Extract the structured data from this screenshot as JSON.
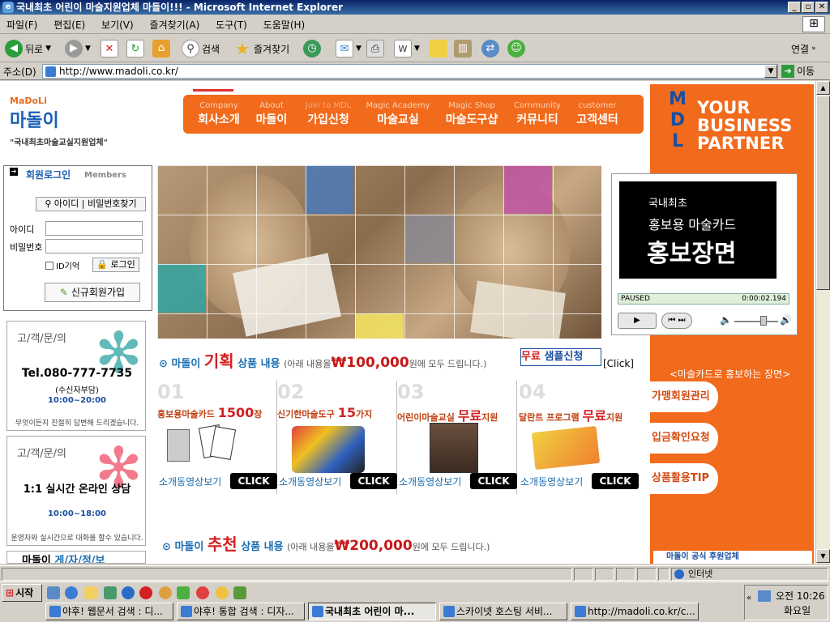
{
  "window": {
    "title": "국내최초 어린이 마술지원업체 마돌이!!! - Microsoft Internet Explorer"
  },
  "menu": [
    "파일(F)",
    "편집(E)",
    "보기(V)",
    "즐겨찾기(A)",
    "도구(T)",
    "도움말(H)"
  ],
  "toolbar": {
    "back": "뒤로",
    "search": "검색",
    "favorites": "즐겨찾기",
    "links": "연결"
  },
  "address": {
    "label": "주소(D)",
    "url": "http://www.madoli.co.kr/",
    "go": "이동"
  },
  "logo": {
    "small": "MaDoLi",
    "big": "마돌이",
    "slogan": "\"국내최초마술교실지원업체\""
  },
  "nav": [
    {
      "en": "Company",
      "ko": "회사소개"
    },
    {
      "en": "About",
      "ko": "마돌이"
    },
    {
      "en": "Join to MDL",
      "ko": "가입신청"
    },
    {
      "en": "Magic Academy",
      "ko": "마술교실"
    },
    {
      "en": "Magic Shop",
      "ko": "마술도구샵"
    },
    {
      "en": "Community",
      "ko": "커뮤니티"
    },
    {
      "en": "customer",
      "ko": "고객센터"
    }
  ],
  "banner": {
    "letters": [
      "M",
      "D",
      "L"
    ],
    "line1": "YOUR",
    "line2": "BUSINESS",
    "line3": "PARTNER"
  },
  "player": {
    "line1": "국내최초",
    "line2": "홍보용 마술카드",
    "line3": "홍보장면",
    "status": "PAUSED",
    "time": "0:00:02.194",
    "caption": "<마술카드로 홍보하는 장면>"
  },
  "side_buttons": [
    "가맹회원관리",
    "입금확인요청",
    "상품활용TIP"
  ],
  "sponsor": "마돌이 공식 후원업체",
  "login": {
    "title": "회원로그인",
    "title_en": "Members",
    "find": "아이디 | 비밀번호찾기",
    "id_label": "아이디",
    "pw_label": "비밀번호",
    "save_id": "ID기억",
    "login_btn": "로그인",
    "join_btn": "신규회원가입"
  },
  "customer1": {
    "heading": "고/객/문/의",
    "tel": "Tel.080-777-7735",
    "sub": "(수신자부담)",
    "hours": "10:00~20:00",
    "note": "무엇이든지 친절히 답변해 드리겠습니다."
  },
  "customer2": {
    "heading": "고/객/문/의",
    "main": "1:1 실시간 온라인 상담",
    "hours": "10:00~18:00",
    "note": "운영자와 실시간으로 대화를 할수 있습니다."
  },
  "customer3": {
    "brand": "마돌이",
    "rest": "게/자/정/보"
  },
  "section1": {
    "prefix": "마돌이",
    "highlight": "기획",
    "suffix": "상품 내용",
    "paren": "(아래 내용을",
    "price": "₩100,000",
    "tail": "원에 모두 드립니다.)",
    "sample_red": "무료",
    "sample_blue": "샘플신청",
    "click": "[Click]"
  },
  "products": [
    {
      "num": "01",
      "pre": "홍보용마술카드",
      "bold": "1500",
      "post": "장",
      "video": "소개동영상보기",
      "click": "CLICK"
    },
    {
      "num": "02",
      "pre": "신기한마술도구",
      "bold": "15",
      "post": "가지",
      "video": "소개동영상보기",
      "click": "CLICK"
    },
    {
      "num": "03",
      "pre": "어린이마술교실",
      "bold": "무료",
      "post": "지원",
      "video": "소개동영상보기",
      "click": "CLICK"
    },
    {
      "num": "04",
      "pre": "달란트 프로그램",
      "bold": "무료",
      "post": "지원",
      "video": "소개동영상보기",
      "click": "CLICK"
    }
  ],
  "section2": {
    "prefix": "마돌이",
    "highlight": "추천",
    "suffix": "상품 내용",
    "paren": "(아래 내용을",
    "price": "₩200,000",
    "tail": "원에 모두 드립니다.)"
  },
  "status": {
    "zone": "인터넷"
  },
  "taskbar": {
    "start": "시작",
    "tasks": [
      "야후! 웹문서 검색 : 디...",
      "야후! 통합 검색 : 디자...",
      "국내최초 어린이 마...",
      "스카이넷 호스팅 서비...",
      "http://madoli.co.kr/c..."
    ],
    "time": "오전 10:26",
    "day": "화요일"
  },
  "colors": {
    "orange": "#f26a1b",
    "blue": "#1a6cb0",
    "red": "#d42020"
  }
}
